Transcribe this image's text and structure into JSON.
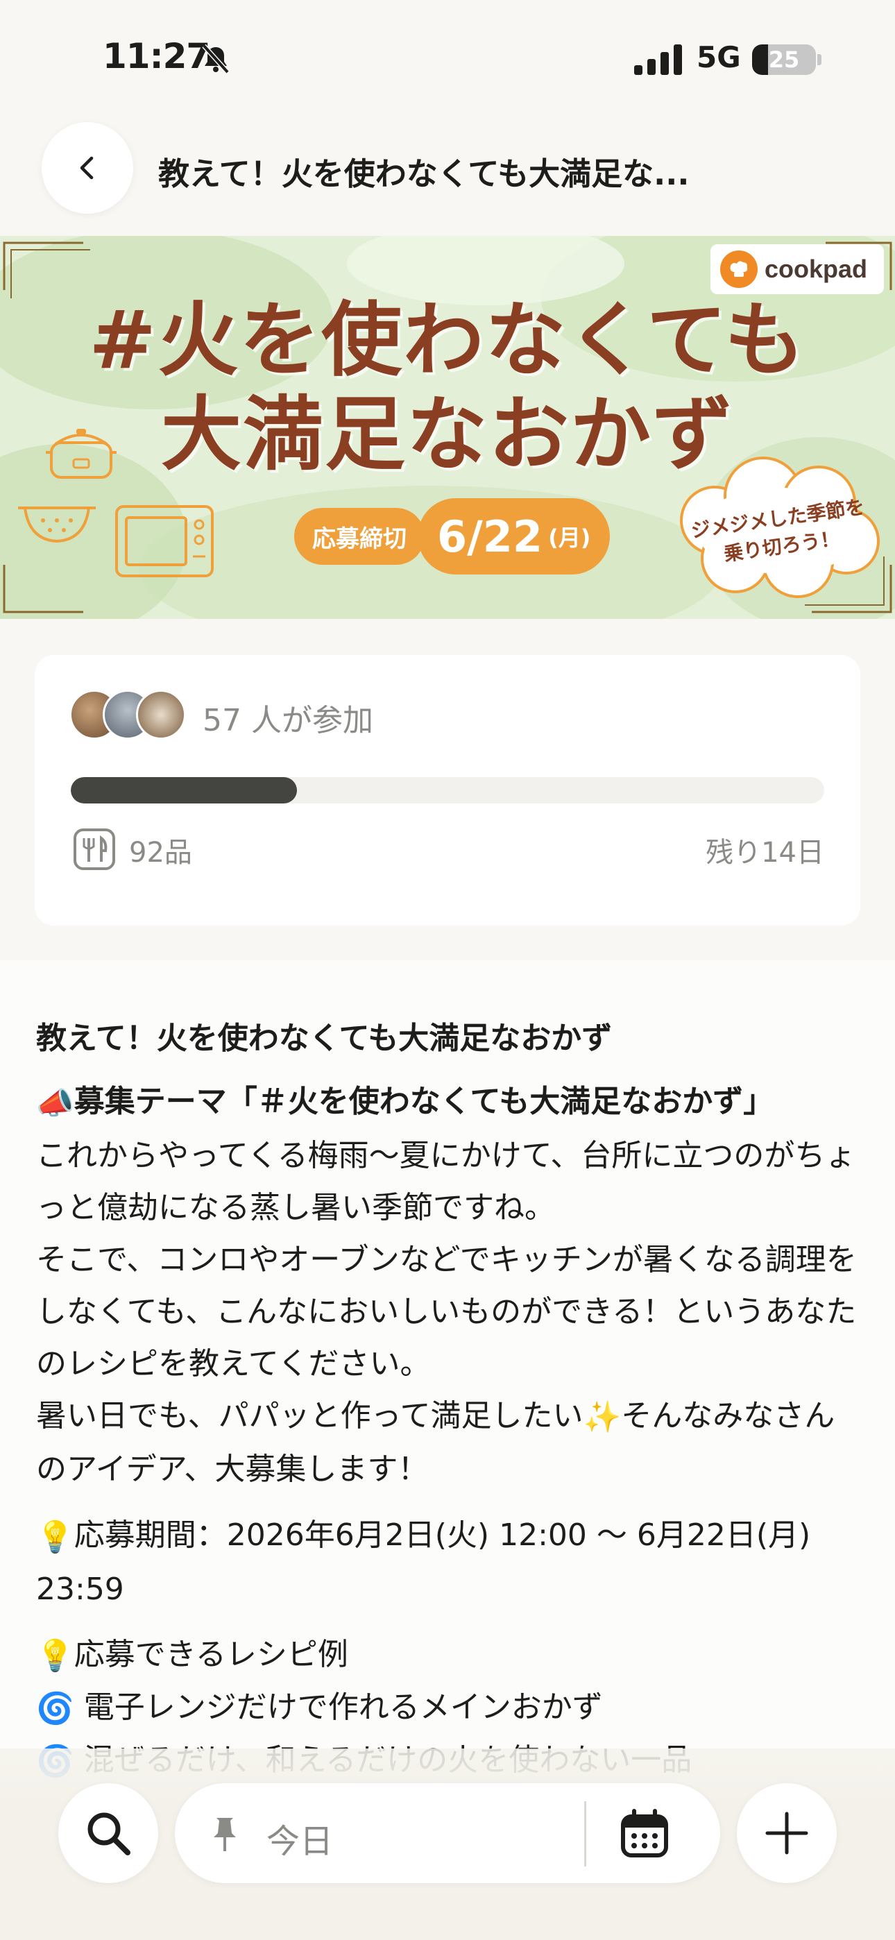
{
  "status_bar": {
    "time": "11:27",
    "network": "5G",
    "battery": "25",
    "battery_level": 0.25,
    "icons": [
      "bell-slash-icon",
      "signal-bars-icon",
      "battery-icon"
    ]
  },
  "header": {
    "back_icon": "chevron-left-icon",
    "title": "教えて！火を使わなくても大満足な..."
  },
  "banner": {
    "headline_line1": "#火を使わなくても",
    "headline_line2": "大満足なおかず",
    "deadline_label": "応募締切",
    "deadline_date": "6/22",
    "deadline_weekday": "(月)",
    "brand": "cookpad",
    "cloud_line1": "ジメジメした季節を",
    "cloud_line2": "乗り切ろう！",
    "colors": {
      "headline": "#8b3f22",
      "accent": "#efa03b",
      "background": "#dfeccf"
    },
    "icons": [
      "rice-cooker-icon",
      "colander-icon",
      "microwave-icon"
    ]
  },
  "progress": {
    "participants": "57 人が参加",
    "progress_fraction": 0.3,
    "recipes": "92品",
    "remaining": "残り14日",
    "recipes_icon": "cutlery-icon"
  },
  "content": {
    "heading": "教えて！火を使わなくても大満足なおかず",
    "theme_emoji": "📣",
    "theme_title": "募集テーマ「＃火を使わなくても大満足なおかず」",
    "paragraph1": "これからやってくる梅雨〜夏にかけて、台所に立つのがちょっと億劫になる蒸し暑い季節ですね。",
    "paragraph2": "そこで、コンロやオーブンなどでキッチンが暑くなる調理をしなくても、こんなにおいしいものができる！というあなたのレシピを教えてください。",
    "paragraph3_before": "暑い日でも、パパッと作って満足したい",
    "sparkle": "✨",
    "paragraph3_after": "そんなみなさんのアイデア、大募集します！",
    "bulb": "💡",
    "period": "応募期間：2026年6月2日(火) 12:00 〜 6月22日(月) 23:59",
    "examples_title": "応募できるレシピ例",
    "swirl": "🌀",
    "example1": "電子レンジだけで作れるメインおかず",
    "example2": "混ぜるだけ、和えるだけの火を使わない一品"
  },
  "bottom_bar": {
    "search_icon": "search-icon",
    "pin_icon": "pin-icon",
    "date_label": "今日",
    "calendar_icon": "calendar-icon",
    "add_icon": "plus-icon"
  }
}
